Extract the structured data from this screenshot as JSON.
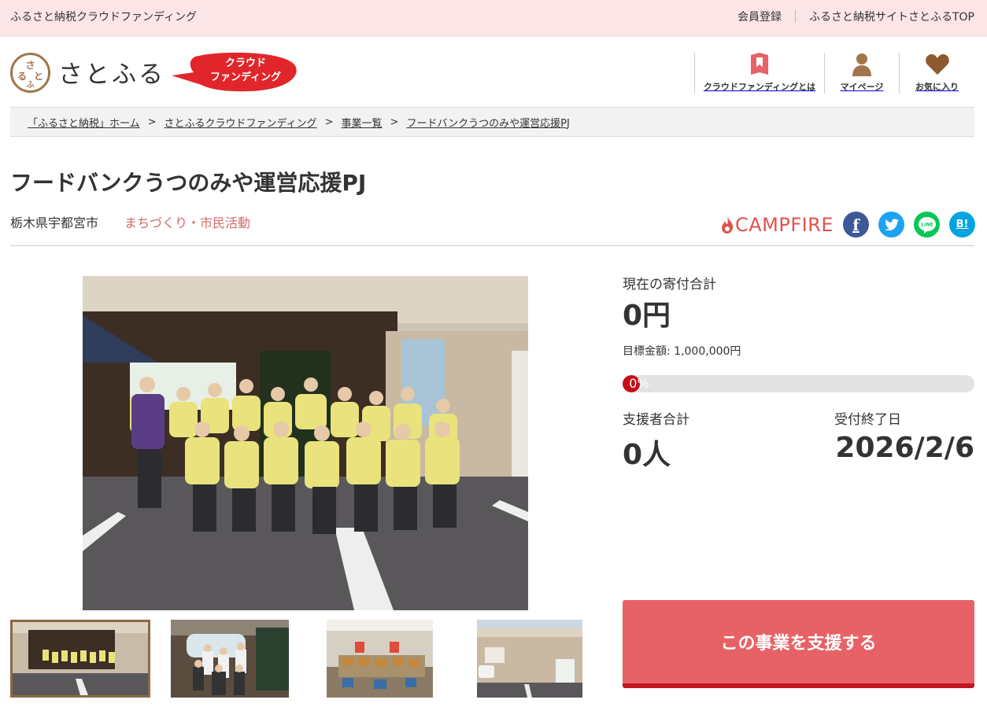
{
  "topbar": {
    "tagline": "ふるさと納税クラウドファンディング",
    "links": [
      {
        "label": "会員登録"
      },
      {
        "label": "ふるさと納税サイトさとふるTOP"
      }
    ]
  },
  "header": {
    "logo_mark": "さとふる",
    "logo_text": "さとふる",
    "badge": {
      "line1": "クラウド",
      "line2": "ファンディング"
    },
    "nav": [
      {
        "label": "クラウドファンディングとは",
        "icon": "bookmark-book-icon"
      },
      {
        "label": "マイページ",
        "icon": "person-icon"
      },
      {
        "label": "お気に入り",
        "icon": "heart-icon"
      }
    ]
  },
  "breadcrumb": [
    {
      "label": "「ふるさと納税」ホーム"
    },
    {
      "label": "さとふるクラウドファンディング"
    },
    {
      "label": "事業一覧"
    },
    {
      "label": "フードバンクうつのみや運営応援PJ"
    }
  ],
  "project": {
    "title": "フードバンクうつのみや運営応援PJ",
    "location": "栃木県宇都宮市",
    "category": "まちづくり・市民活動",
    "partner": "CAMPFIRE"
  },
  "share": [
    {
      "name": "facebook",
      "glyph": "f",
      "color": "#3b5998"
    },
    {
      "name": "twitter",
      "glyph": "t",
      "color": "#1da1f2"
    },
    {
      "name": "line",
      "glyph": "LINE",
      "color": "#06c755"
    },
    {
      "name": "hatena",
      "glyph": "B!",
      "color": "#00a4de"
    }
  ],
  "stats": {
    "total_label": "現在の寄付合計",
    "total_value": "0円",
    "goal_text": "目標金額: 1,000,000円",
    "progress_percent": 0,
    "progress_label": "0%",
    "supporters_label": "支援者合計",
    "supporters_value": "0人",
    "deadline_label": "受付終了日",
    "deadline_value": "2026/2/6"
  },
  "cta": {
    "label": "この事業を支援する"
  },
  "colors": {
    "accent": "#e76266",
    "accent_dark": "#c11522",
    "topbar_bg": "#fbe5e6",
    "category": "#d26a6a",
    "brand_brown": "#a0764a"
  }
}
